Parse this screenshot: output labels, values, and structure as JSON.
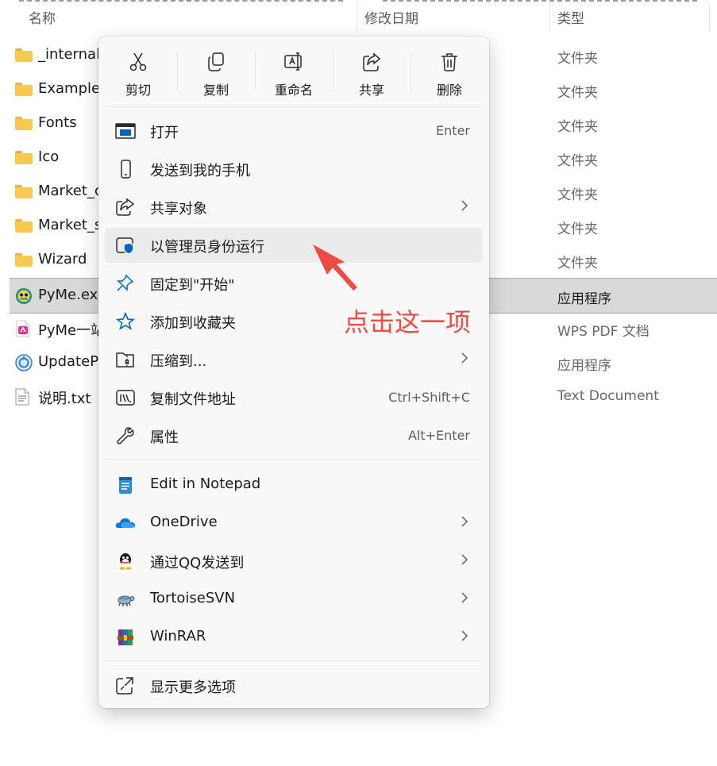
{
  "columns": {
    "name": "名称",
    "modified": "修改日期",
    "type": "类型"
  },
  "files": [
    {
      "name": "_internal",
      "type": "文件夹",
      "icon": "folder-icon"
    },
    {
      "name": "Example",
      "type": "文件夹",
      "icon": "folder-icon"
    },
    {
      "name": "Fonts",
      "type": "文件夹",
      "icon": "folder-icon"
    },
    {
      "name": "Ico",
      "type": "文件夹",
      "icon": "folder-icon"
    },
    {
      "name": "Market_c",
      "type": "文件夹",
      "icon": "folder-icon"
    },
    {
      "name": "Market_s",
      "type": "文件夹",
      "icon": "folder-icon"
    },
    {
      "name": "Wizard",
      "type": "文件夹",
      "icon": "folder-icon"
    },
    {
      "name": "PyMe.exe",
      "type": "应用程序",
      "icon": "pyme-app-icon"
    },
    {
      "name": "PyMe一站",
      "type": "WPS PDF 文档",
      "icon": "pdf-icon"
    },
    {
      "name": "UpdateP",
      "type": "应用程序",
      "icon": "update-app-icon"
    },
    {
      "name": "说明.txt",
      "type": "Text Document",
      "icon": "text-file-icon"
    }
  ],
  "menu": {
    "toolbar": {
      "cut": "剪切",
      "copy": "复制",
      "rename": "重命名",
      "share": "共享",
      "delete": "删除"
    },
    "items": [
      {
        "label": "打开",
        "shortcut": "Enter",
        "icon": "open-window-icon"
      },
      {
        "label": "发送到我的手机",
        "icon": "phone-icon"
      },
      {
        "label": "共享对象",
        "icon": "share-icon",
        "submenu": true
      },
      {
        "label": "以管理员身份运行",
        "icon": "admin-shield-icon"
      },
      {
        "label": "固定到\"开始\"",
        "icon": "pin-icon"
      },
      {
        "label": "添加到收藏夹",
        "icon": "star-icon"
      },
      {
        "label": "压缩到...",
        "icon": "zip-icon",
        "submenu": true
      },
      {
        "label": "复制文件地址",
        "shortcut": "Ctrl+Shift+C",
        "icon": "copy-path-icon"
      },
      {
        "label": "属性",
        "shortcut": "Alt+Enter",
        "icon": "wrench-icon"
      }
    ],
    "items2": [
      {
        "label": "Edit in Notepad",
        "icon": "notepad-icon"
      },
      {
        "label": "OneDrive",
        "icon": "onedrive-icon",
        "submenu": true
      },
      {
        "label": "通过QQ发送到",
        "icon": "qq-icon",
        "submenu": true
      },
      {
        "label": "TortoiseSVN",
        "icon": "tortoisesvn-icon",
        "submenu": true
      },
      {
        "label": "WinRAR",
        "icon": "winrar-icon",
        "submenu": true
      }
    ],
    "more": {
      "label": "显示更多选项",
      "icon": "more-options-icon"
    }
  },
  "annotation": {
    "text": "点击这一项",
    "color": "#ee4b43"
  },
  "colors": {
    "accent": "#0067c0",
    "selection": "#d9d9d9"
  }
}
